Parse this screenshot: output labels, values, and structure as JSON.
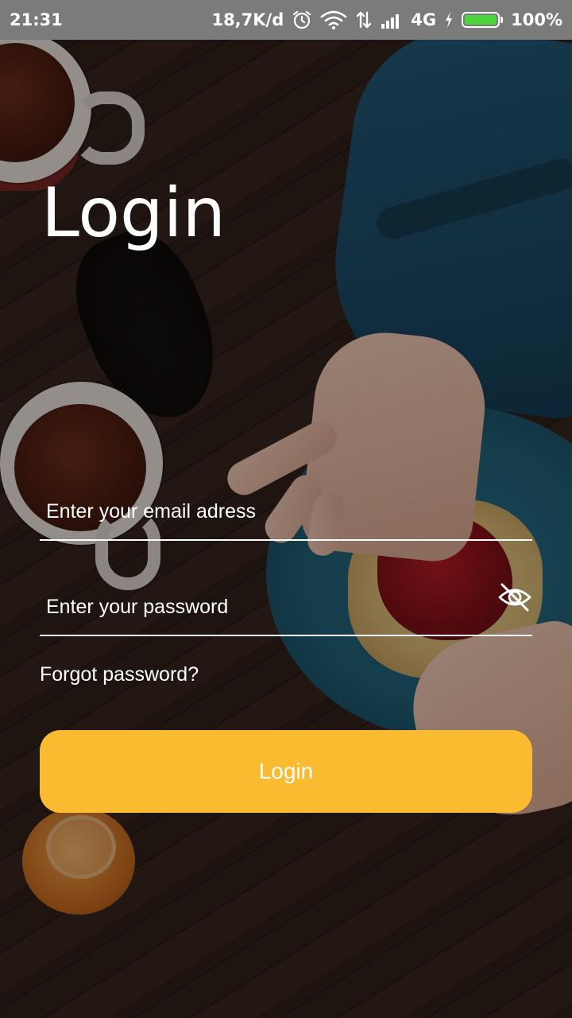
{
  "status_bar": {
    "time": "21:31",
    "network_speed": "18,7K/d",
    "alarm_icon": "alarm-clock-icon",
    "wifi_icon": "wifi-icon",
    "data_icon": "data-transfer-icon",
    "signal_icon": "cell-signal-icon",
    "network_type": "4G",
    "charging_icon": "charging-bolt-icon",
    "battery_percent": "100%",
    "battery_level": 1.0,
    "battery_color": "#4cd43d",
    "background_color": "#7b7b7b"
  },
  "login": {
    "title": "Login",
    "email_placeholder": "Enter your email adress",
    "email_value": "",
    "password_placeholder": "Enter your password",
    "password_value": "",
    "password_toggle_icon": "eye-off-icon",
    "forgot_password_label": "Forgot password?",
    "submit_label": "Login",
    "accent_color": "#fbbb31",
    "text_color": "#ffffff"
  }
}
